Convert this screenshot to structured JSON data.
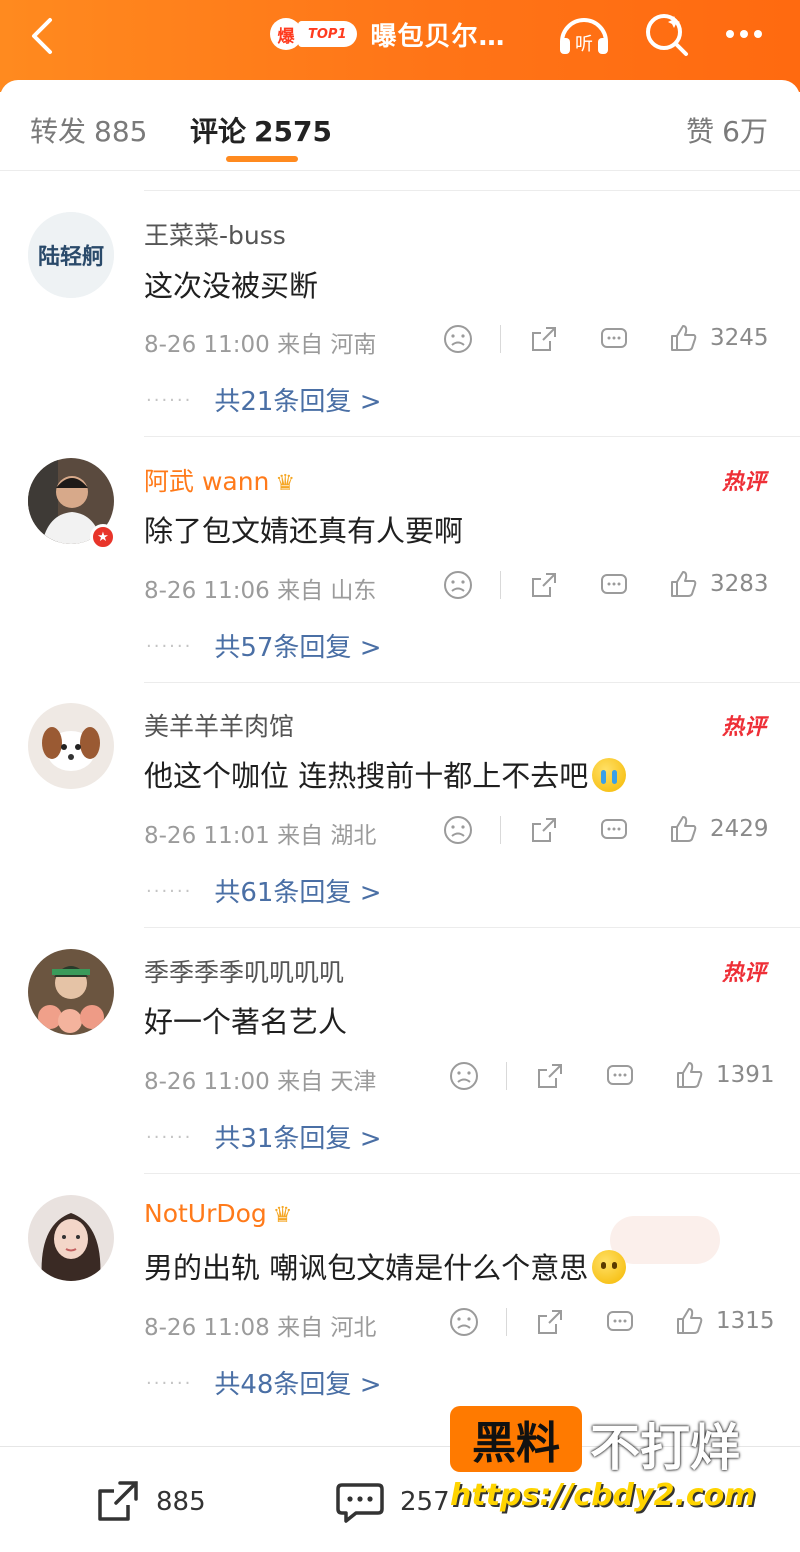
{
  "header": {
    "badge_bao": "爆",
    "badge_top": "TOP1",
    "title": "曝包贝尔…",
    "listen_label": "听"
  },
  "tabs": {
    "forward": {
      "label": "转发",
      "count": "885"
    },
    "comment": {
      "label": "评论",
      "count": "2575"
    },
    "like": {
      "label": "赞",
      "count": "6万"
    }
  },
  "comments": [
    {
      "name": "王菜菜-buss",
      "vip": false,
      "hot": "",
      "text": "这次没被买断",
      "emoji": "",
      "time": "8-26 11:00",
      "from": "来自",
      "location": "河南",
      "likes": "3245",
      "replies": "共21条回复 >",
      "avatar_text": "陆轻舸"
    },
    {
      "name": "阿武 wann",
      "vip": true,
      "hot": "热评",
      "text": "除了包文婧还真有人要啊",
      "emoji": "",
      "time": "8-26 11:06",
      "from": "来自",
      "location": "山东",
      "likes": "3283",
      "replies": "共57条回复 >"
    },
    {
      "name": "美羊羊羊肉馆",
      "vip": false,
      "hot": "热评",
      "text": "他这个咖位 连热搜前十都上不去吧",
      "emoji": "cry",
      "time": "8-26 11:01",
      "from": "来自",
      "location": "湖北",
      "likes": "2429",
      "replies": "共61条回复 >"
    },
    {
      "name": "季季季季叽叽叽叽",
      "vip": false,
      "hot": "热评",
      "text": "好一个著名艺人",
      "emoji": "",
      "time": "8-26 11:00",
      "from": "来自",
      "location": "天津",
      "likes": "1391",
      "replies": "共31条回复 >"
    },
    {
      "name": "NotUrDog",
      "vip": true,
      "hot": "",
      "text": "男的出轨 嘲讽包文婧是什么个意思",
      "emoji": "question",
      "time": "8-26 11:08",
      "from": "来自",
      "location": "河北",
      "likes": "1315",
      "replies": "共48条回复 >"
    }
  ],
  "bottom": {
    "forward_count": "885",
    "comment_count": "257"
  },
  "watermark": {
    "box_text": "黑料",
    "text": "不打烊",
    "url": "https://cbdy2.com"
  },
  "colors": {
    "header_orange": "#ff7a1a",
    "reply_link": "#4a6fa5",
    "hot_red": "#ee2f37",
    "vip_name": "#ff7a1a"
  }
}
